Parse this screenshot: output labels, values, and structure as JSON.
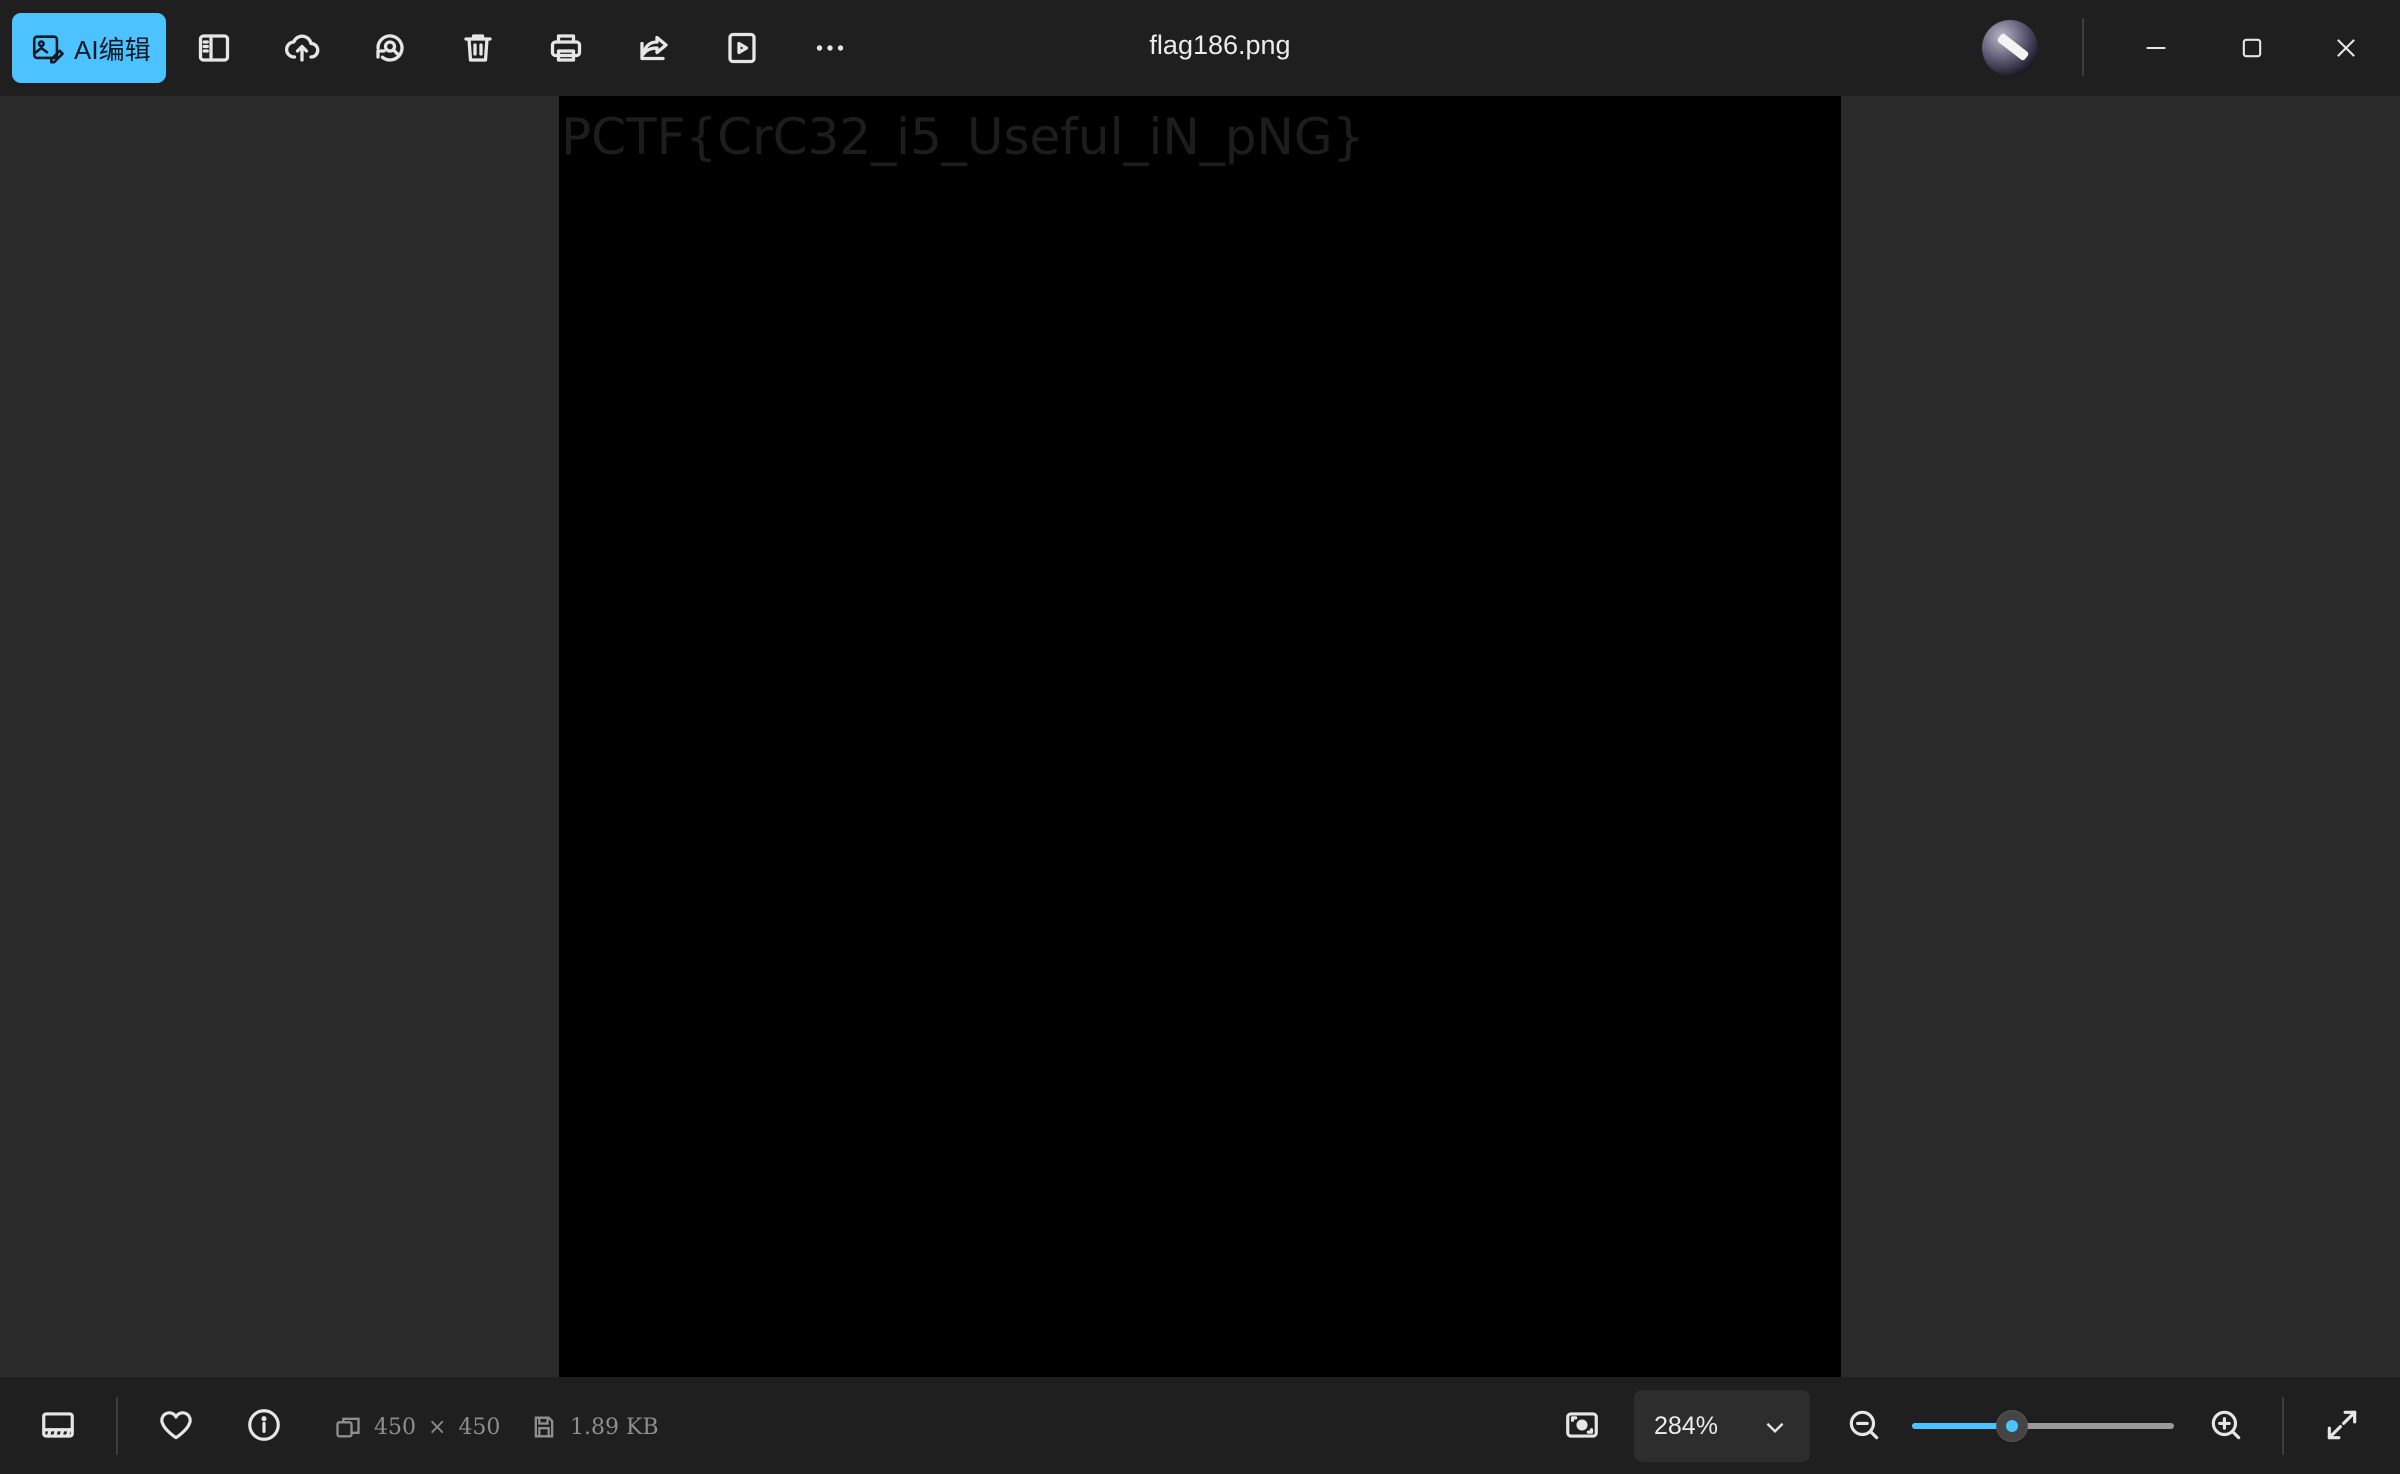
{
  "toolbar": {
    "ai_edit_label": "AI编辑",
    "tools": [
      "sidebar-icon",
      "upload-cloud-icon",
      "rotate-search-icon",
      "delete-icon",
      "print-icon",
      "share-icon",
      "slideshow-icon",
      "more-icon"
    ]
  },
  "window": {
    "title": "flag186.png"
  },
  "image": {
    "flag_text": "PCTF{CrC32_i5_Useful_iN_pNG}"
  },
  "status": {
    "width": "450",
    "times": "×",
    "height": "450",
    "file_size": "1.89 KB",
    "zoom": "284%",
    "zoom_slider_fraction": 0.38
  },
  "colors": {
    "accent": "#4cc2ff",
    "bar_bg": "#1f1f1f",
    "viewer_bg": "#2b2b2b"
  }
}
